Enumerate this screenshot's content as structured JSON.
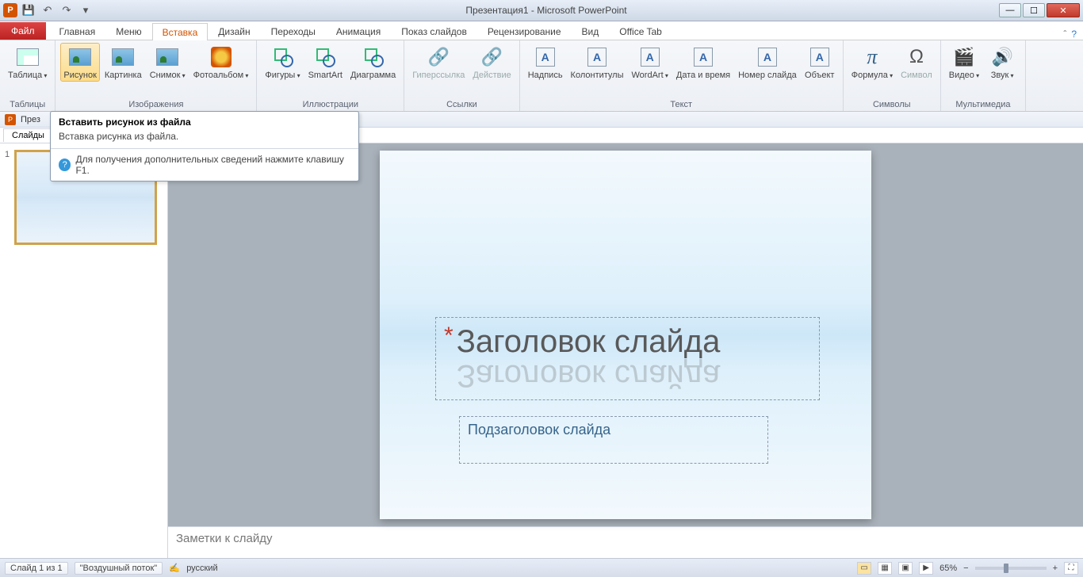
{
  "title": "Презентация1 - Microsoft PowerPoint",
  "qat": {
    "undo": "↶",
    "redo": "↷",
    "save": "💾"
  },
  "tabs": {
    "file": "Файл",
    "items": [
      "Главная",
      "Меню",
      "Вставка",
      "Дизайн",
      "Переходы",
      "Анимация",
      "Показ слайдов",
      "Рецензирование",
      "Вид",
      "Office Tab"
    ],
    "active": "Вставка"
  },
  "ribbon": {
    "groups": [
      {
        "label": "Таблицы",
        "buttons": [
          {
            "name": "table-button",
            "label": "Таблица",
            "icon": "ic-table",
            "dd": true
          }
        ]
      },
      {
        "label": "Изображения",
        "buttons": [
          {
            "name": "picture-button",
            "label": "Рисунок",
            "icon": "ic-img",
            "hover": true
          },
          {
            "name": "clip-art-button",
            "label": "Картинка",
            "icon": "ic-img"
          },
          {
            "name": "screenshot-button",
            "label": "Снимок",
            "icon": "ic-img",
            "dd": true
          },
          {
            "name": "photo-album-button",
            "label": "Фотоальбом",
            "icon": "ic-sun",
            "dd": true
          }
        ]
      },
      {
        "label": "Иллюстрации",
        "buttons": [
          {
            "name": "shapes-button",
            "label": "Фигуры",
            "icon": "ic-shapes",
            "dd": true
          },
          {
            "name": "smartart-button",
            "label": "SmartArt",
            "icon": "ic-shapes"
          },
          {
            "name": "chart-button",
            "label": "Диаграмма",
            "icon": "ic-shapes"
          }
        ]
      },
      {
        "label": "Ссылки",
        "buttons": [
          {
            "name": "hyperlink-button",
            "label": "Гиперссылка",
            "icon": "ic-link",
            "disabled": true
          },
          {
            "name": "action-button",
            "label": "Действие",
            "icon": "ic-link",
            "disabled": true
          }
        ]
      },
      {
        "label": "Текст",
        "buttons": [
          {
            "name": "textbox-button",
            "label": "Надпись",
            "icon": "ic-text"
          },
          {
            "name": "header-footer-button",
            "label": "Колонтитулы",
            "icon": "ic-text"
          },
          {
            "name": "wordart-button",
            "label": "WordArt",
            "icon": "ic-text",
            "dd": true
          },
          {
            "name": "date-time-button",
            "label": "Дата и время",
            "icon": "ic-text"
          },
          {
            "name": "slide-number-button",
            "label": "Номер слайда",
            "icon": "ic-text"
          },
          {
            "name": "object-button",
            "label": "Объект",
            "icon": "ic-text"
          }
        ]
      },
      {
        "label": "Символы",
        "buttons": [
          {
            "name": "equation-button",
            "label": "Формула",
            "icon": "ic-pi",
            "dd": true
          },
          {
            "name": "symbol-button",
            "label": "Символ",
            "icon": "ic-omega",
            "disabled": true
          }
        ]
      },
      {
        "label": "Мультимедиа",
        "buttons": [
          {
            "name": "video-button",
            "label": "Видео",
            "icon": "ic-clip",
            "dd": true
          },
          {
            "name": "audio-button",
            "label": "Звук",
            "icon": "ic-sound",
            "dd": true
          }
        ]
      }
    ]
  },
  "tooltip": {
    "title": "Вставить рисунок из файла",
    "body": "Вставка рисунка из файла.",
    "foot": "Для получения дополнительных сведений нажмите клавишу F1."
  },
  "doc": {
    "name": "През"
  },
  "sidetab": "Слайды",
  "thumb_num": "1",
  "slide": {
    "title": "Заголовок слайда",
    "subtitle": "Подзаголовок слайда"
  },
  "notes_placeholder": "Заметки к слайду",
  "status": {
    "slide_pos": "Слайд 1 из 1",
    "theme": "\"Воздушный поток\"",
    "lang": "русский",
    "zoom": "65%"
  }
}
